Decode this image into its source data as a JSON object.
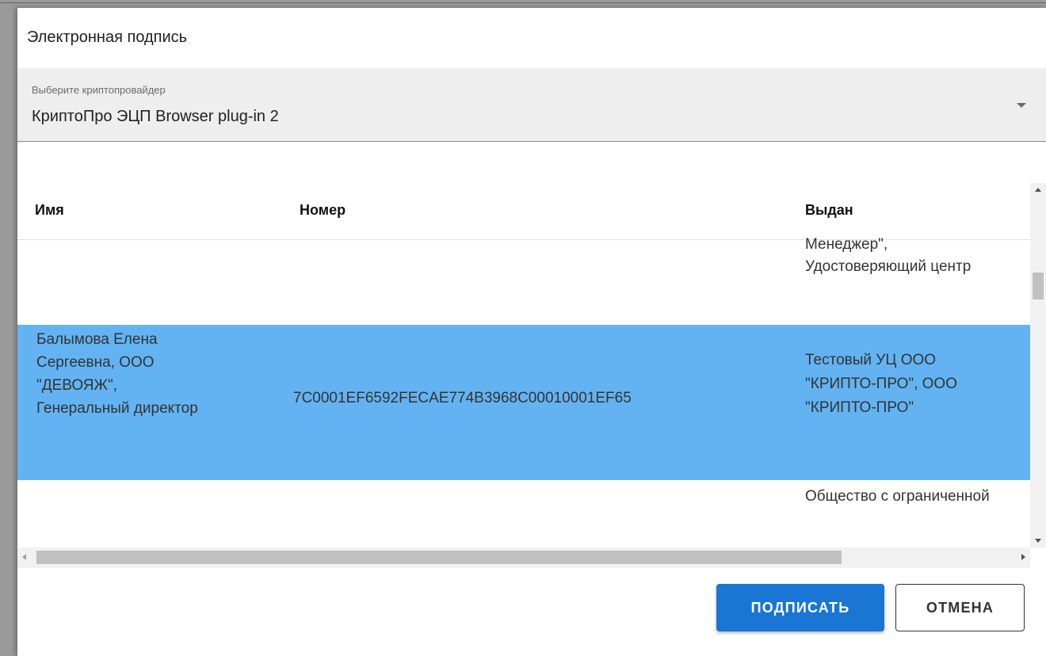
{
  "dialog": {
    "title": "Электронная подпись"
  },
  "provider_select": {
    "label": "Выберите криптопровайдер",
    "value": "КриптоПро ЭЦП Browser plug-in 2"
  },
  "table": {
    "columns": [
      "Имя",
      "Номер",
      "Выдан"
    ],
    "rows": [
      {
        "name": "",
        "number": "",
        "issuer": "Менеджер\", Удостоверяющий центр"
      },
      {
        "name": "Балымова Елена Сергеевна, ООО \"ДЕВОЯЖ\", Генеральный директор",
        "number": "7C0001EF6592FECAE774B3968C00010001EF65",
        "issuer": "Тестовый УЦ ООО \"КРИПТО-ПРО\", ООО \"КРИПТО-ПРО\"",
        "selected": true
      },
      {
        "name": "",
        "number": "",
        "issuer": "Общество с ограниченной"
      }
    ]
  },
  "actions": {
    "sign_label": "ПОДПИСАТЬ",
    "cancel_label": "ОТМЕНА"
  },
  "colors": {
    "primary": "#1976d2",
    "selected_row": "#63b3f2",
    "select_bg": "#eeeeee"
  }
}
